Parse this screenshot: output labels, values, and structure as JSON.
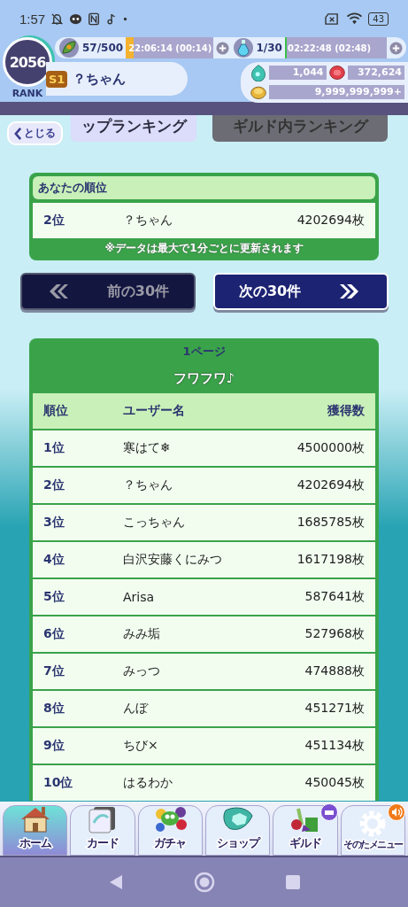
{
  "status_bar": {
    "time": "1:57",
    "battery": "43"
  },
  "header": {
    "rank": "2056",
    "rank_label": "RANK",
    "grade": "S1",
    "player_name": "？ちゃん",
    "stamina": {
      "value": "57/500",
      "timer": "22:06:14 (00:14)",
      "level": 0.09
    },
    "potion": {
      "value": "1/30",
      "timer": "02:22:48 (02:48)",
      "level": 0.02
    },
    "currencies": [
      {
        "kind": "gem",
        "value": "1,044"
      },
      {
        "kind": "ruby",
        "value": "372,624"
      },
      {
        "kind": "coin",
        "value": "9,999,999,999+"
      }
    ]
  },
  "tabs": [
    {
      "label": "ップランキング",
      "selected": true
    },
    {
      "label": "ギルド内ランキング",
      "selected": false
    }
  ],
  "close_button": {
    "label": "とじる"
  },
  "your_rank": {
    "title": "あなたの順位",
    "rank": "2位",
    "name": "？ちゃん",
    "score": "4202694枚",
    "note": "※データは最大で**1分**ごとに更新されます"
  },
  "pager": [
    {
      "label": "前の30件",
      "kind": "prev",
      "disabled": true
    },
    {
      "label": "次の30件",
      "kind": "next",
      "disabled": false
    }
  ],
  "ranking": {
    "page": "1ページ",
    "title": "フワフワ♪",
    "columns": [
      "順位",
      "ユーザー名",
      "獲得数"
    ],
    "rows": [
      {
        "rank": "1位",
        "name": "寒はて❄",
        "score": "4500000枚"
      },
      {
        "rank": "2位",
        "name": "？ちゃん",
        "score": "4202694枚"
      },
      {
        "rank": "3位",
        "name": "こっちゃん",
        "score": "1685785枚"
      },
      {
        "rank": "4位",
        "name": "白沢安藤くにみつ",
        "score": "1617198枚"
      },
      {
        "rank": "5位",
        "name": "Arisa",
        "score": "587641枚"
      },
      {
        "rank": "6位",
        "name": "みみ垢",
        "score": "527968枚"
      },
      {
        "rank": "7位",
        "name": "みっつ",
        "score": "474888枚"
      },
      {
        "rank": "8位",
        "name": "んぼ",
        "score": "451271枚"
      },
      {
        "rank": "9位",
        "name": "ちび×",
        "score": "451134枚"
      },
      {
        "rank": "10位",
        "name": "はるわか",
        "score": "450045枚"
      }
    ]
  },
  "bottom_nav": [
    {
      "label": "ホーム",
      "kind": "home",
      "selected": true
    },
    {
      "label": "カード",
      "kind": "card",
      "selected": false
    },
    {
      "label": "ガチャ",
      "kind": "gacha",
      "selected": false
    },
    {
      "label": "ショップ",
      "kind": "shop",
      "selected": false
    },
    {
      "label": "ギルド",
      "kind": "guild",
      "selected": false
    },
    {
      "label": "そのたメニュー",
      "kind": "menu",
      "selected": false
    }
  ]
}
